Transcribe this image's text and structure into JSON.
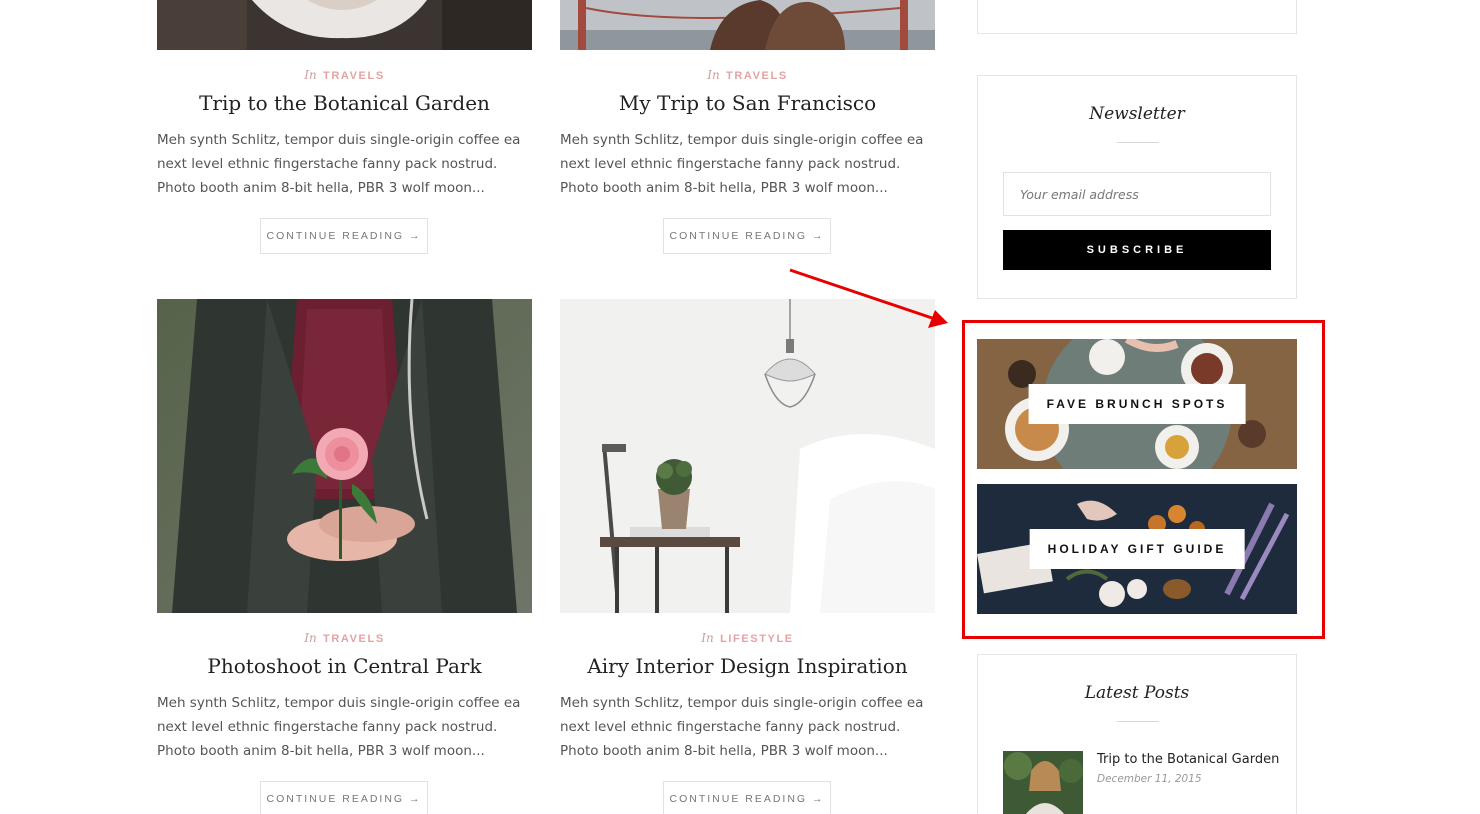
{
  "posts": [
    {
      "meta_in": "In",
      "category": "TRAVELS",
      "title": "Trip to the Botanical Garden",
      "excerpt": "Meh synth Schlitz, tempor duis single-origin coffee ea next level ethnic fingerstache fanny pack nostrud. Photo booth anim 8-bit hella, PBR 3 wolf moon...",
      "button": "CONTINUE READING →"
    },
    {
      "meta_in": "In",
      "category": "TRAVELS",
      "title": "My Trip to San Francisco",
      "excerpt": "Meh synth Schlitz, tempor duis single-origin coffee ea next level ethnic fingerstache fanny pack nostrud. Photo booth anim 8-bit hella, PBR 3 wolf moon...",
      "button": "CONTINUE READING →"
    },
    {
      "meta_in": "In",
      "category": "TRAVELS",
      "title": "Photoshoot in Central Park",
      "excerpt": "Meh synth Schlitz, tempor duis single-origin coffee ea next level ethnic fingerstache fanny pack nostrud. Photo booth anim 8-bit hella, PBR 3 wolf moon...",
      "button": "CONTINUE READING →"
    },
    {
      "meta_in": "In",
      "category": "LIFESTYLE",
      "title": "Airy Interior Design Inspiration",
      "excerpt": "Meh synth Schlitz, tempor duis single-origin coffee ea next level ethnic fingerstache fanny pack nostrud. Photo booth anim 8-bit hella, PBR 3 wolf moon...",
      "button": "CONTINUE READING →"
    }
  ],
  "sidebar": {
    "newsletter": {
      "title": "Newsletter",
      "placeholder": "Your email address",
      "button": "SUBSCRIBE"
    },
    "promos": [
      {
        "label": "FAVE BRUNCH SPOTS"
      },
      {
        "label": "HOLIDAY GIFT GUIDE"
      }
    ],
    "latest_posts": {
      "title": "Latest Posts",
      "items": [
        {
          "title": "Trip to the Botanical Garden",
          "date": "December 11, 2015"
        }
      ]
    }
  },
  "colors": {
    "category": "#e3a3a3",
    "subscribe_bg": "#000000",
    "annotation": "#e80000"
  }
}
